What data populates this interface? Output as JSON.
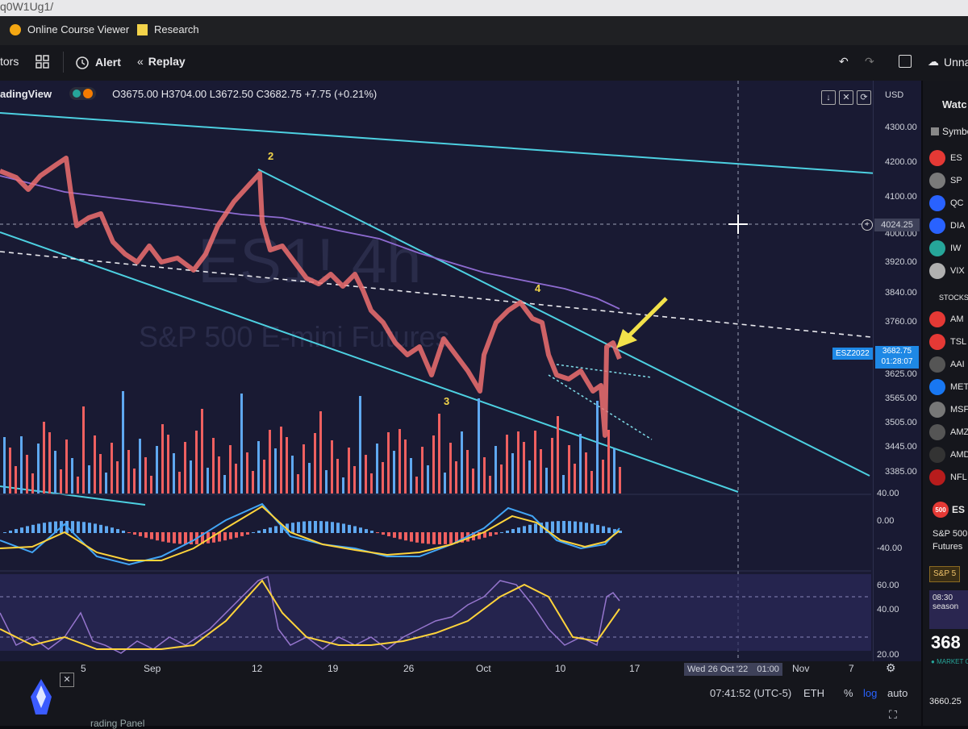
{
  "browser": {
    "url_fragment": "q0W1Ug1/",
    "bookmarks": [
      {
        "label": "Online Course Viewer",
        "icon": "shield-icon"
      },
      {
        "label": "Research",
        "icon": "folder-icon"
      }
    ]
  },
  "toolbar": {
    "indicators_label": "tors",
    "alert_label": "Alert",
    "replay_label": "Replay",
    "right_label": "Unna"
  },
  "chart": {
    "brand": "adingView",
    "ohlc": "O3675.00 H3704.00 L3672.50 C3682.75 +7.75 (+0.21%)",
    "watermark_symbol": "ES1! 4h",
    "watermark_name": "S&P 500 E-mini Futures",
    "currency": "USD",
    "wave_labels": [
      "2",
      "4",
      "3"
    ],
    "price_ticks": [
      "4300.00",
      "4200.00",
      "4100.00",
      "4024.25",
      "4000.00",
      "3920.00",
      "3840.00",
      "3760.00",
      "3682.75",
      "3625.00",
      "3565.00",
      "3505.00",
      "3445.00",
      "3385.00"
    ],
    "last_price_tag": {
      "symbol": "ESZ2022",
      "price": "3682.75",
      "countdown": "01:28:07"
    },
    "macd_ticks": [
      "40.00",
      "0.00",
      "-40.00"
    ],
    "rsi_ticks": [
      "60.00",
      "40.00",
      "20.00"
    ],
    "time_ticks": [
      "5",
      "Sep",
      "12",
      "19",
      "26",
      "Oct",
      "10",
      "17",
      "Nov",
      "7"
    ],
    "crosshair_date": "Wed 26 Oct '22",
    "crosshair_time": "01:00"
  },
  "bottom": {
    "clock": "07:41:52 (UTC-5)",
    "session": "ETH",
    "percent": "%",
    "log": "log",
    "auto": "auto",
    "panel_label": "rading Panel"
  },
  "watchlist": {
    "title": "Watc",
    "symbol_header": "Symbo",
    "items": [
      {
        "symbol": "ES",
        "color": "#e53935"
      },
      {
        "symbol": "SP",
        "color": "#7a7a7a"
      },
      {
        "symbol": "QC",
        "color": "#2962ff"
      },
      {
        "symbol": "DIA",
        "color": "#2962ff"
      },
      {
        "symbol": "IW",
        "color": "#26a69a"
      },
      {
        "symbol": "VIX",
        "color": "#b0b0b0"
      }
    ],
    "section_stocks": "STOCKS",
    "stocks": [
      {
        "symbol": "AM",
        "color": "#e53935"
      },
      {
        "symbol": "TSL",
        "color": "#e53935"
      },
      {
        "symbol": "AAI",
        "color": "#555555"
      },
      {
        "symbol": "MET",
        "color": "#1877f2"
      },
      {
        "symbol": "MSF",
        "color": "#777777"
      },
      {
        "symbol": "AMZ",
        "color": "#555555"
      },
      {
        "symbol": "AMD",
        "color": "#333333"
      },
      {
        "symbol": "NFL",
        "color": "#b71c1c"
      }
    ],
    "detail": {
      "symbol": "ES",
      "name": "S&P 500 E",
      "sub": "Futures",
      "tag": "S&P 5",
      "news_time": "08:30",
      "news_text": "season",
      "price": "368",
      "market_status": "MARKET C",
      "bottom_price": "3660.25"
    }
  },
  "colors": {
    "chart_bg": "#191a33",
    "up": "#5fa8f0",
    "down": "#ef6060",
    "trendline": "#4dd0e1",
    "ma": "#8e6bd1",
    "signal": "#ffd43b",
    "arrow": "#f2e14a"
  }
}
